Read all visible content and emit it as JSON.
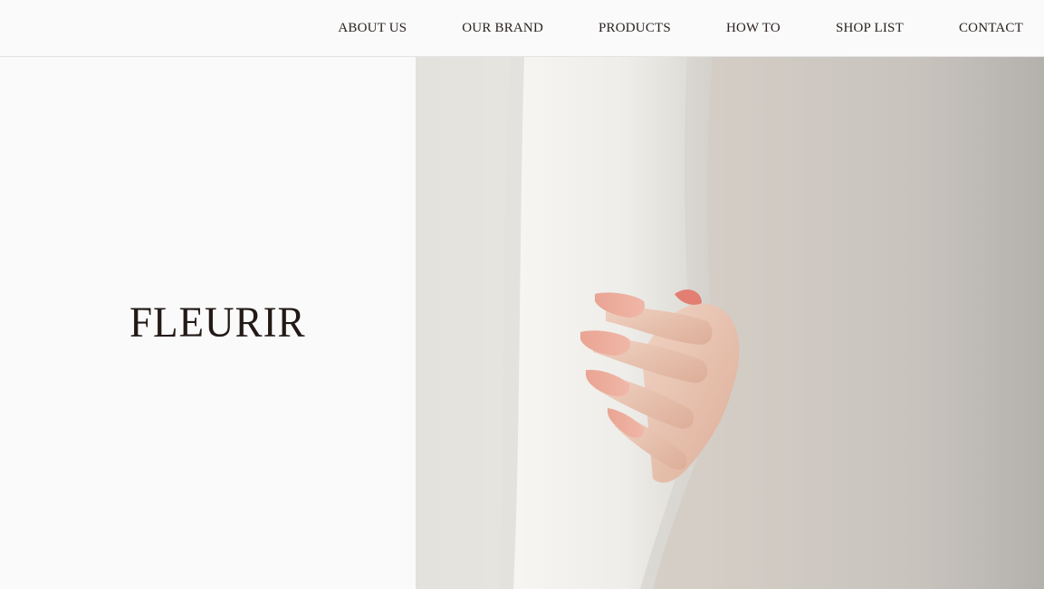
{
  "nav": {
    "items": [
      {
        "label": "ABOUT US"
      },
      {
        "label": "OUR BRAND"
      },
      {
        "label": "PRODUCTS"
      },
      {
        "label": "HOW TO"
      },
      {
        "label": "SHOP LIST"
      },
      {
        "label": "CONTACT"
      }
    ]
  },
  "brand": {
    "logo_text": "FLEURIR"
  },
  "colors": {
    "background": "#fafafa",
    "text": "#231916",
    "nail_polish": "#e8a99a"
  }
}
